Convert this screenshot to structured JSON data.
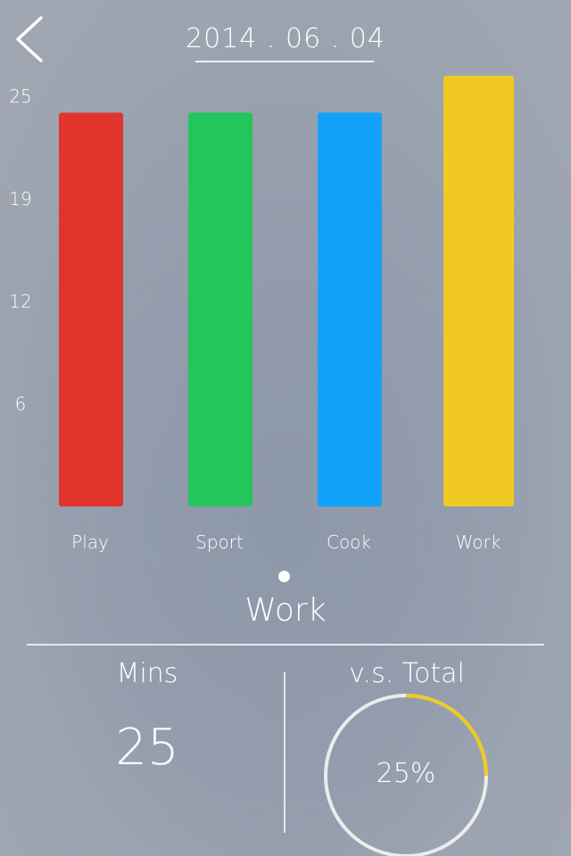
{
  "header": {
    "date": "2014 . 06 . 04",
    "back_icon": "chevron-left-icon"
  },
  "chart_data": {
    "type": "bar",
    "categories": [
      "Play",
      "Sport",
      "Cook",
      "Work"
    ],
    "values": [
      24,
      24,
      24,
      25
    ],
    "colors": [
      "#e1342c",
      "#23c65a",
      "#12a2fb",
      "#f0ca22"
    ],
    "selected": "Work",
    "y_ticks": [
      "25",
      "19",
      "12",
      "6"
    ],
    "ylim": [
      0,
      25
    ],
    "grid": false,
    "legend": "none"
  },
  "selection": {
    "label": "Work"
  },
  "stats": {
    "mins_title": "Mins",
    "mins_value": "25",
    "total_title": "v.s. Total",
    "percent_label": "25%",
    "percent_fraction": 0.25,
    "ring_color": "#f0ca22",
    "track_color": "#ececec"
  }
}
